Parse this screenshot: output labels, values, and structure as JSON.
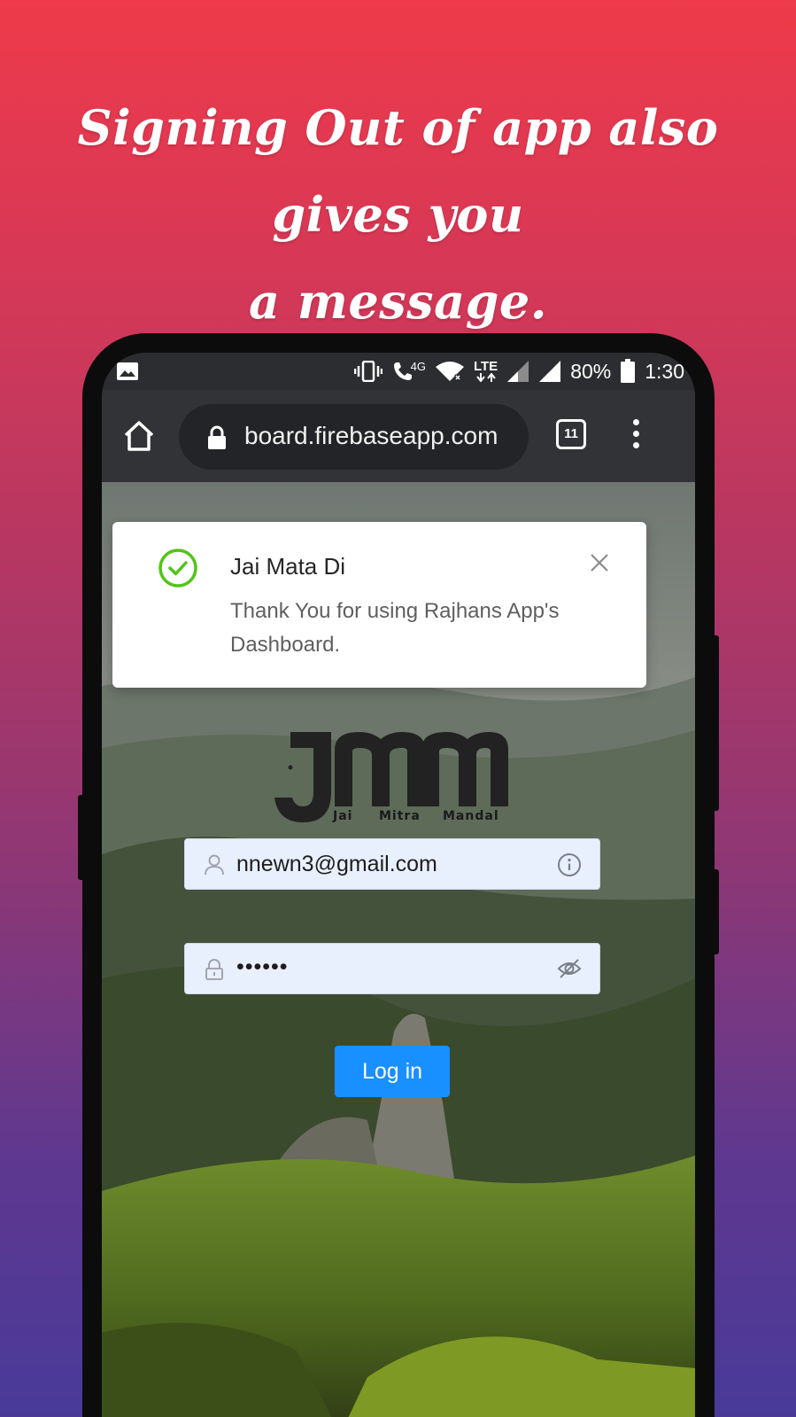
{
  "headline": {
    "line1": "Signing Out of app also gives you",
    "line2": "a message."
  },
  "status_bar": {
    "network_badge": "4G",
    "lte_label": "LTE",
    "battery": "80%",
    "time": "1:30",
    "icons": [
      "gallery-icon",
      "vibrate-icon",
      "volte-call-icon",
      "wifi-icon",
      "lte-data-icon",
      "signal-icon",
      "signal-icon",
      "battery-icon"
    ]
  },
  "browser": {
    "url": "board.firebaseapp.com",
    "tab_count": "11",
    "icons": [
      "home-icon",
      "lock-icon",
      "tabs-icon",
      "more-vert-icon"
    ]
  },
  "notification": {
    "title": "Jai Mata Di",
    "message": "Thank You for using Rajhans App's Dashboard.",
    "status": "success",
    "accent": "#52c41a"
  },
  "logo": {
    "letters": "JMM",
    "words": [
      "Jai",
      "Mitra",
      "Mandal"
    ]
  },
  "login_form": {
    "email_value": "nnewn3@gmail.com",
    "password_value": "••••••",
    "submit_label": "Log in",
    "submit_color": "#1890ff",
    "icons": [
      "user-icon",
      "info-icon",
      "lock-icon",
      "eye-off-icon"
    ]
  },
  "colors": {
    "gradient_top": "#ee3a4a",
    "gradient_bottom": "#493a99",
    "browser_chrome": "#323336"
  }
}
